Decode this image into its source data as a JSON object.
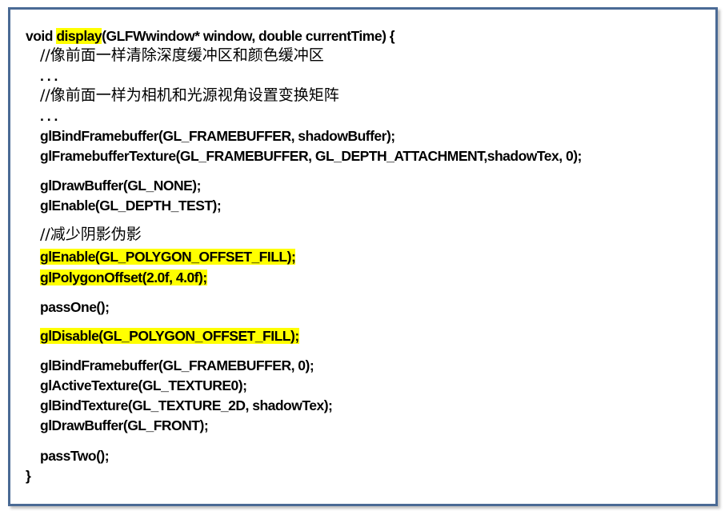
{
  "code": {
    "header_keyword": "void ",
    "header_function": "display",
    "header_rest": "(GLFWwindow* window, double currentTime) {",
    "comment_1": "//像前面一样清除深度缓冲区和颜色缓冲区",
    "ellipsis_1": ". . .",
    "comment_2": "//像前面一样为相机和光源视角设置变换矩阵",
    "ellipsis_2": ". . .",
    "line_bind_fb": "glBindFramebuffer(GL_FRAMEBUFFER, shadowBuffer);",
    "line_fb_texture": "glFramebufferTexture(GL_FRAMEBUFFER, GL_DEPTH_ATTACHMENT,shadowTex, 0);",
    "line_draw_none": "glDrawBuffer(GL_NONE);",
    "line_enable_depth": "glEnable(GL_DEPTH_TEST);",
    "comment_3": "//减少阴影伪影",
    "line_enable_offset": "glEnable(GL_POLYGON_OFFSET_FILL);",
    "line_polygon_offset": "glPolygonOffset(2.0f, 4.0f);",
    "line_pass_one": "passOne();",
    "line_disable_offset": "glDisable(GL_POLYGON_OFFSET_FILL);",
    "line_bind_fb_zero": "glBindFramebuffer(GL_FRAMEBUFFER, 0);",
    "line_active_texture": "glActiveTexture(GL_TEXTURE0);",
    "line_bind_texture": "glBindTexture(GL_TEXTURE_2D, shadowTex);",
    "line_draw_front": "glDrawBuffer(GL_FRONT);",
    "line_pass_two": "passTwo();",
    "closing_brace": "}"
  },
  "colors": {
    "border": "#4a6a95",
    "highlight": "#ffff00",
    "text": "#000000"
  }
}
